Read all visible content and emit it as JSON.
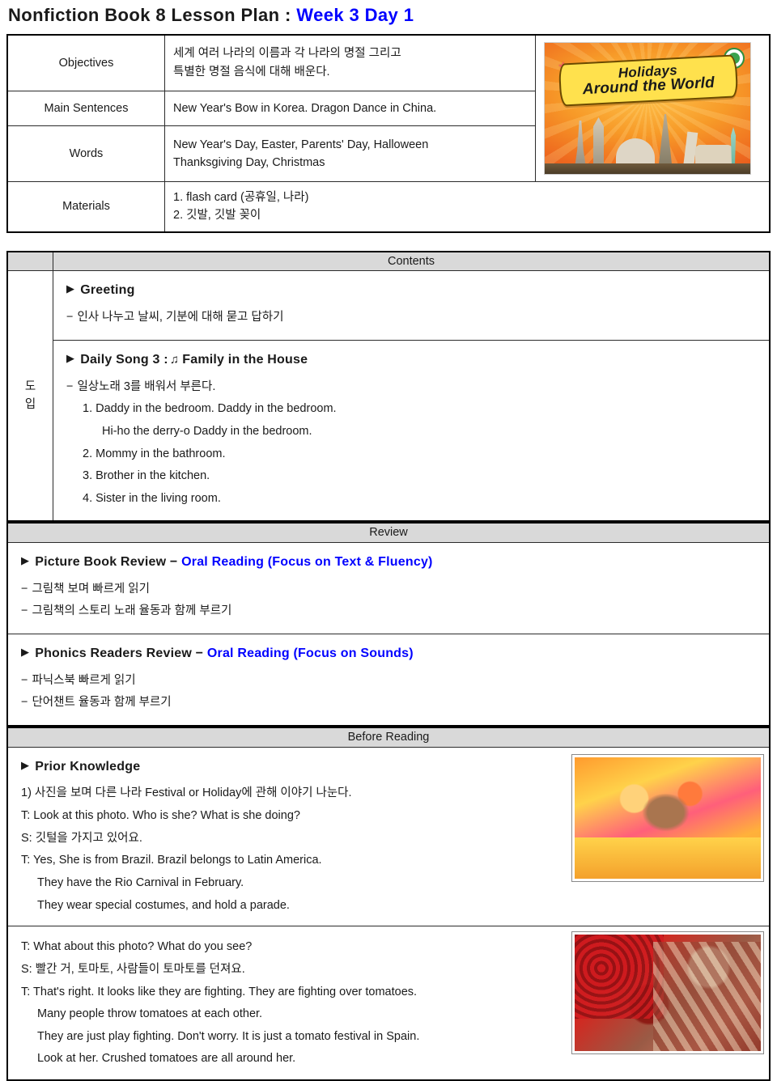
{
  "title": {
    "main": "Nonfiction Book 8 Lesson Plan",
    "separator": ":",
    "accent": "Week 3 Day 1"
  },
  "info_table": {
    "rows": [
      {
        "label": "Objectives",
        "lines": [
          "세계 여러 나라의 이름과 각 나라의 명절 그리고",
          "특별한 명절 음식에 대해 배운다."
        ]
      },
      {
        "label": "Main Sentences",
        "lines": [
          "New Year's Bow in Korea.   Dragon Dance in China."
        ]
      },
      {
        "label": "Words",
        "lines": [
          "New Year's Day, Easter, Parents' Day, Halloween",
          "Thanksgiving Day, Christmas"
        ]
      },
      {
        "label": "Materials",
        "lines": [
          "1. flash card (공휴일, 나라)",
          "2. 깃발, 깃발 꽂이"
        ]
      }
    ],
    "cover_image": {
      "name": "holidays-around-the-world-book-cover",
      "title_line1": "Holidays",
      "title_line2": "Around the World",
      "alt": "Book cover: Holidays Around the World with world landmarks on orange background"
    }
  },
  "contents": {
    "header": "Contents",
    "side_label_1": "도",
    "side_label_2": "입",
    "greeting": {
      "heading": "Greeting",
      "lines": [
        "인사 나누고 날씨, 기분에 대해 묻고 답하기"
      ]
    },
    "daily_song": {
      "heading_prefix": "Daily Song 3 :",
      "note_glyph": "♫",
      "heading_title": "Family in the House",
      "intro": "일상노래 3를 배워서 부른다.",
      "verses": [
        "1. Daddy in the bedroom.   Daddy in the bedroom.",
        "Hi-ho the derry-o   Daddy in the bedroom.",
        "2. Mommy in the bathroom.",
        "3. Brother in the kitchen.",
        "4. Sister in the living room."
      ]
    }
  },
  "review": {
    "header": "Review",
    "blocks": [
      {
        "heading_black": "Picture Book Review −",
        "heading_blue": "Oral Reading (Focus on Text & Fluency)",
        "lines": [
          "그림책 보며 빠르게 읽기",
          "그림책의 스토리 노래 율동과 함께 부르기"
        ]
      },
      {
        "heading_black": "Phonics Readers Review −",
        "heading_blue": "Oral Reading (Focus on Sounds)",
        "lines": [
          "파닉스북 빠르게 읽기",
          "단어챈트 율동과 함께 부르기"
        ]
      }
    ]
  },
  "before_reading": {
    "header": "Before Reading",
    "prior_knowledge": {
      "heading": "Prior Knowledge",
      "item": "1) 사진을 보며 다른 나라 Festival or Holiday에 관해 이야기 나눈다.",
      "dialogue": [
        "T: Look at this photo. Who is she? What is she doing?",
        "S: 깃털을 가지고 있어요.",
        "T: Yes, She is from Brazil. Brazil belongs to Latin America.",
        "They have the Rio Carnival in February.",
        "They wear special costumes, and hold a parade."
      ],
      "photo": {
        "name": "rio-carnival-dancer-photo",
        "alt": "Photo of a smiling Brazilian carnival dancer in orange and yellow feathered costume"
      }
    },
    "second_photo_talk": {
      "dialogue": [
        "T: What about this photo? What do you see?",
        "S: 빨간 거, 토마토, 사람들이 토마토를 던져요.",
        "T: That's right. It looks like they are fighting. They are fighting over tomatoes.",
        "Many people throw tomatoes at each other.",
        "They are just play fighting. Don't worry. It is just a tomato festival in Spain.",
        "Look at her. Crushed tomatoes are all around her."
      ],
      "photo": {
        "name": "la-tomatina-festival-photo",
        "alt": "Photo of people covered in crushed tomatoes at the La Tomatina festival in Spain"
      }
    }
  },
  "colors": {
    "accent_blue": "#0000FF",
    "header_bar_gray": "#D9D9D9",
    "border_dark": "#2B2B2B",
    "text": "#1A1A1A"
  }
}
